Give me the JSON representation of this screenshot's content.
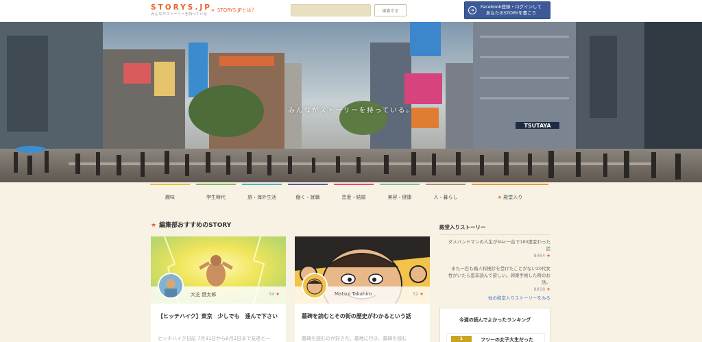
{
  "header": {
    "logo_text": "STORYS.JP",
    "logo_tagline": "みんながストーリーを持っている",
    "about_link": "STORYS.JPとは？",
    "search_placeholder": "",
    "search_button": "検索する",
    "fb_button_line1": "Facebook登録・ログインして",
    "fb_button_line2": "あなたのSTORYを書こう"
  },
  "hero": {
    "tagline": "みんながストーリーを持っている。",
    "sign_text": "TSUTAYA"
  },
  "categories": [
    {
      "label": "趣味",
      "color": "#e3c33a"
    },
    {
      "label": "学生時代",
      "color": "#7cbf5a"
    },
    {
      "label": "旅・海外生活",
      "color": "#48b5c4"
    },
    {
      "label": "働く・就職",
      "color": "#5b5aa8"
    },
    {
      "label": "恋愛・結婚",
      "color": "#e04b7a"
    },
    {
      "label": "美容・健康",
      "color": "#6fc2a4"
    },
    {
      "label": "人・暮らし",
      "color": "#a8926e"
    },
    {
      "label": "殿堂入り",
      "color": "#f0983a"
    }
  ],
  "main": {
    "section_title": "編集部おすすめのSTORY",
    "cards": [
      {
        "author": "大芝 健太郎",
        "likes": "34",
        "title": "【ヒッチハイク】東京　少しでも　遠んで下さい",
        "excerpt": "ヒッチハイク日記 7月31日から8月2日まで友達と一"
      },
      {
        "author": "Matsui Takahiro",
        "likes": "52",
        "title": "墓碑を読むとその街の歴史がわかるという話",
        "excerpt": "墓碑を読むのが好きだ。墓地に行き、墓碑を読む"
      }
    ]
  },
  "sidebar": {
    "title": "殿堂入りストーリー",
    "items": [
      {
        "line1": "ダメバンドマンの人生がMac一台で180度変わった",
        "line2": "話",
        "count": "8464"
      },
      {
        "line1": "また一匹も婚人科検診を受けたことがない20代女",
        "line2": "性がいたら是非読んで欲しい。卵巣手術した時のお",
        "line3": "話。",
        "count": "8818"
      }
    ],
    "more_link": "他の殿堂入りストーリーをみる",
    "ranking": {
      "title": "今週の読んでよかったランキング",
      "first_rank": "1",
      "first_title": "フツーの女子大生だった"
    }
  }
}
